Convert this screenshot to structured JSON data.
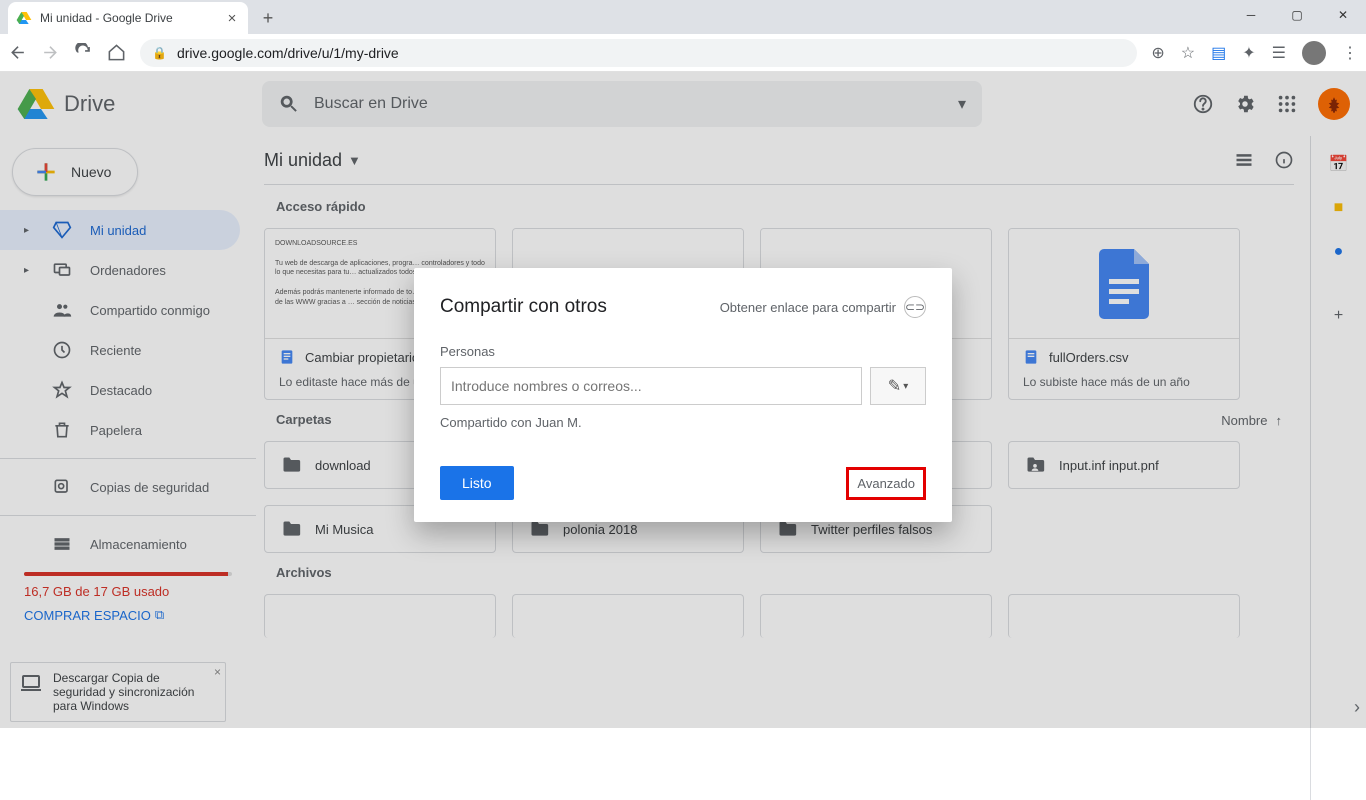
{
  "browser": {
    "tab_title": "Mi unidad - Google Drive",
    "url": "drive.google.com/drive/u/1/my-drive"
  },
  "header": {
    "product": "Drive",
    "search_placeholder": "Buscar en Drive"
  },
  "sidebar": {
    "new_label": "Nuevo",
    "items": [
      {
        "label": "Mi unidad"
      },
      {
        "label": "Ordenadores"
      },
      {
        "label": "Compartido conmigo"
      },
      {
        "label": "Reciente"
      },
      {
        "label": "Destacado"
      },
      {
        "label": "Papelera"
      },
      {
        "label": "Copias de seguridad"
      }
    ],
    "storage_label": "Almacenamiento",
    "storage_usage": "16,7 GB de 17 GB usado",
    "buy_label": "COMPRAR ESPACIO"
  },
  "main": {
    "path": "Mi unidad",
    "quick_title": "Acceso rápido",
    "quick": [
      {
        "title": "Cambiar propietario…",
        "sub": "Lo editaste hace más de u…"
      },
      {
        "title": "",
        "sub": ""
      },
      {
        "title": "",
        "sub": ""
      },
      {
        "title": "fullOrders.csv",
        "sub": "Lo subiste hace más de un año"
      }
    ],
    "folders_title": "Carpetas",
    "sort_label": "Nombre",
    "folders": [
      "download",
      "",
      "",
      "Input.inf input.pnf",
      "Mi Musica",
      "polonia 2018",
      "Twitter perfiles falsos"
    ],
    "files_title": "Archivos"
  },
  "dialog": {
    "title": "Compartir con otros",
    "get_link": "Obtener enlace para compartir",
    "people_label": "Personas",
    "input_placeholder": "Introduce nombres o correos...",
    "shared_with": "Compartido con Juan M.",
    "done": "Listo",
    "advanced": "Avanzado"
  },
  "backup_prompt": "Descargar Copia de seguridad y sincronización para Windows"
}
